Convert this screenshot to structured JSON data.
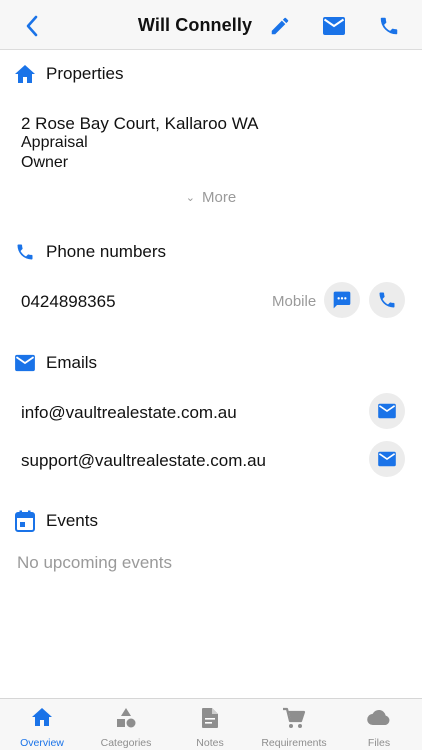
{
  "header": {
    "title": "Will Connelly",
    "icons": {
      "back": "chevron-left-icon",
      "edit": "pencil-icon",
      "mail": "mail-icon",
      "phone": "phone-icon"
    }
  },
  "properties": {
    "heading": "Properties",
    "address": "2 Rose Bay Court, Kallaroo WA",
    "type": "Appraisal",
    "role": "Owner",
    "more_label": "More"
  },
  "phones": {
    "heading": "Phone numbers",
    "items": [
      {
        "number": "0424898365",
        "label": "Mobile"
      }
    ]
  },
  "emails": {
    "heading": "Emails",
    "items": [
      {
        "address": "info@vaultrealestate.com.au"
      },
      {
        "address": "support@vaultrealestate.com.au"
      }
    ]
  },
  "events": {
    "heading": "Events",
    "empty": "No upcoming events"
  },
  "tabbar": {
    "active": "Overview",
    "tabs": [
      {
        "label": "Overview",
        "icon": "home-icon"
      },
      {
        "label": "Categories",
        "icon": "shapes-icon"
      },
      {
        "label": "Notes",
        "icon": "note-icon"
      },
      {
        "label": "Requirements",
        "icon": "cart-icon"
      },
      {
        "label": "Files",
        "icon": "cloud-icon"
      }
    ]
  },
  "colors": {
    "accent": "#1a73e8",
    "muted": "#9a9a9a",
    "icon_grey": "#8e8e8e"
  }
}
